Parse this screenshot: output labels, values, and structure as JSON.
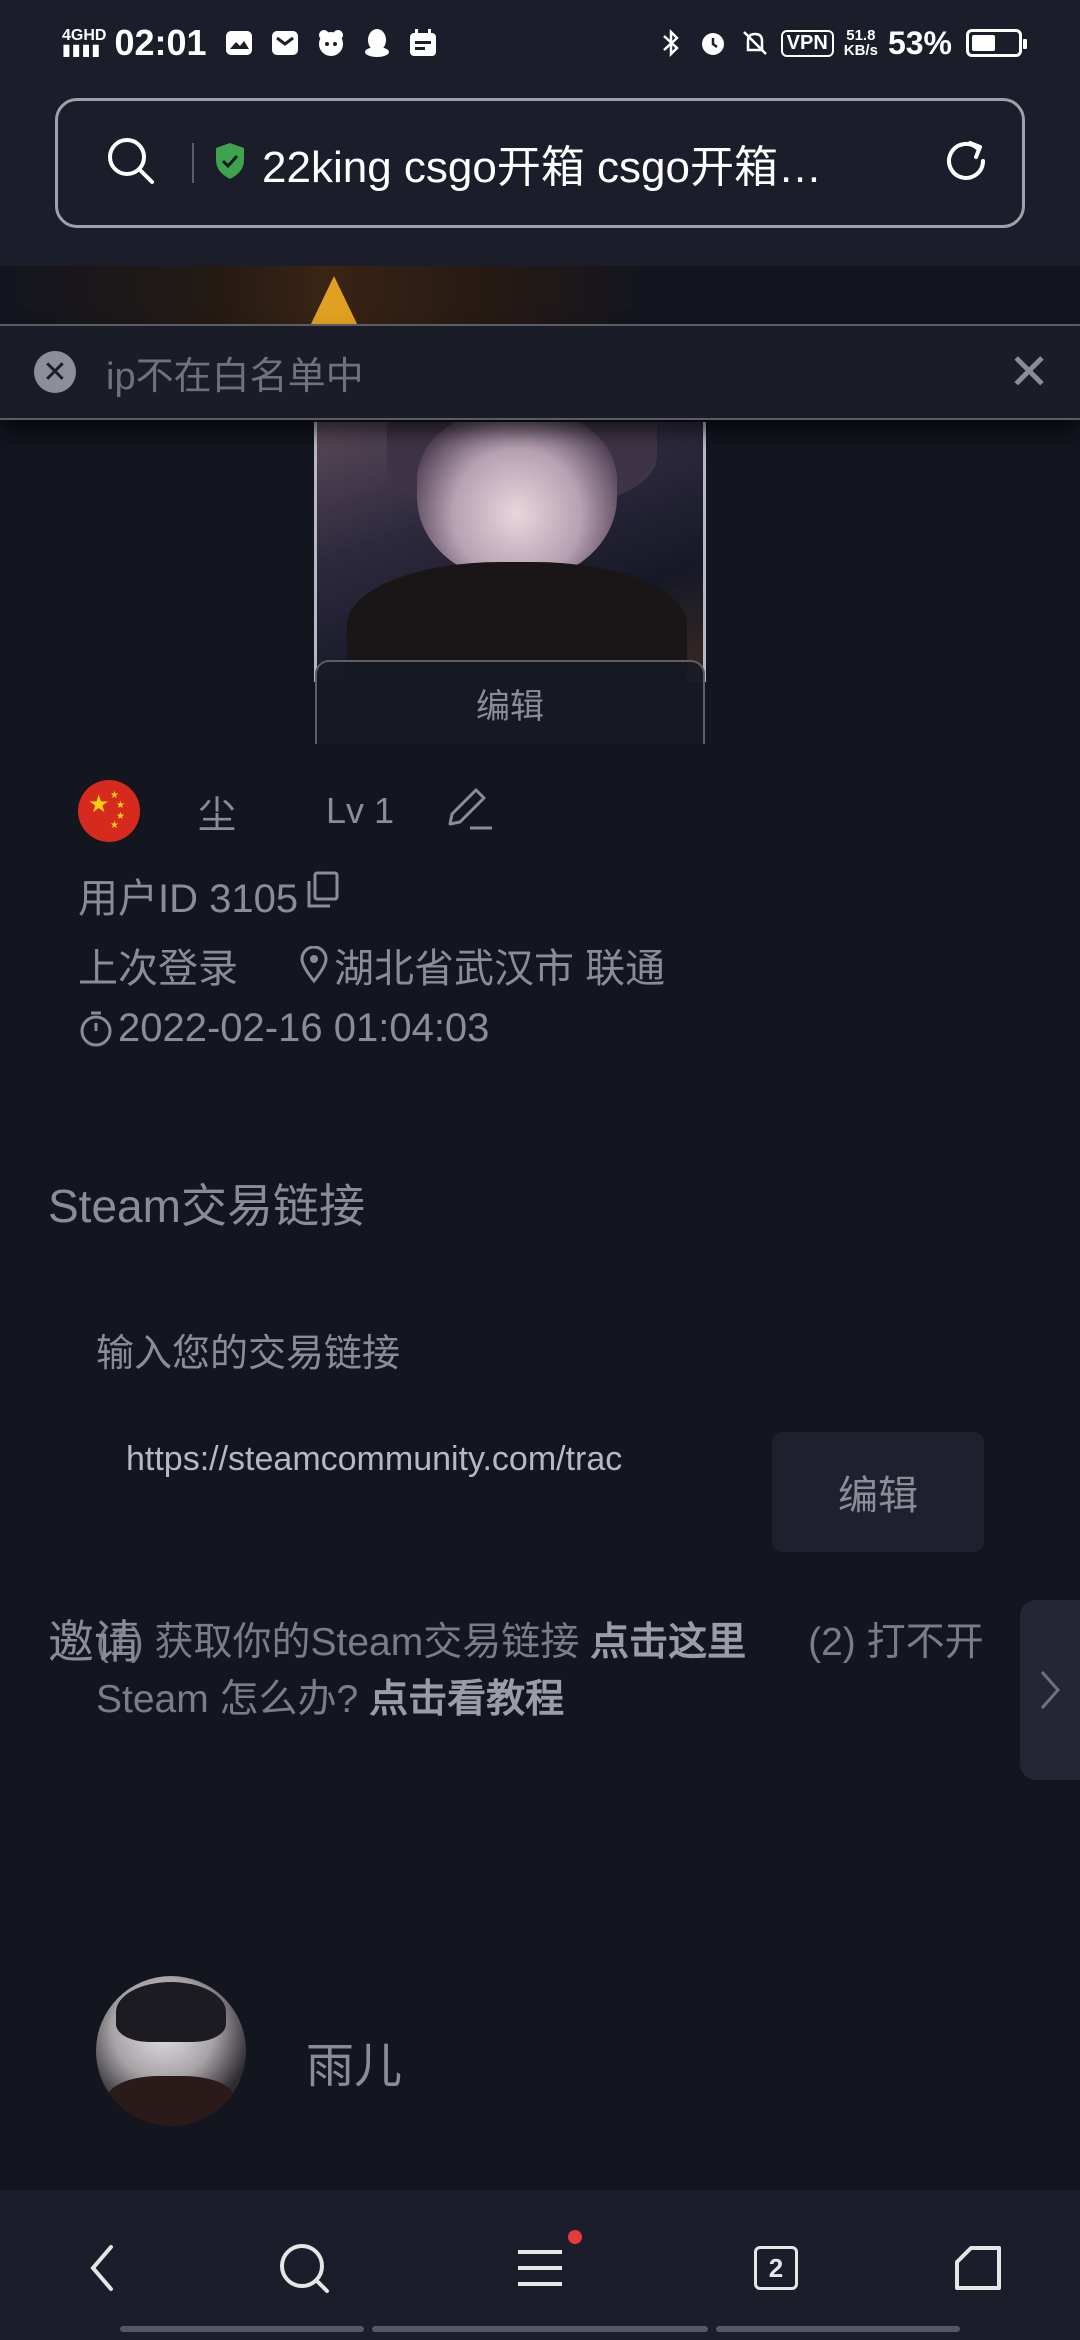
{
  "status_bar": {
    "network": "4GHD",
    "time": "02:01",
    "vpn": "VPN",
    "speed_value": "51.8",
    "speed_unit": "KB/s",
    "battery_percent": "53%",
    "battery_level": 0.53
  },
  "browser": {
    "url": "22king csgo开箱 csgo开箱…",
    "icons": [
      "search-icon",
      "shield-check-icon",
      "reload-icon"
    ],
    "secure_color": "#3fa34d"
  },
  "toast": {
    "message": "ip不在白名单中"
  },
  "profile": {
    "edit_avatar_label": "编辑",
    "nickname": "尘",
    "level": "Lv 1",
    "user_id": "用户ID 3105",
    "last_login_label": "上次登录",
    "location": "湖北省武汉市 联通",
    "last_login_time": "2022-02-16 01:04:03"
  },
  "trade": {
    "section_title": "Steam交易链接",
    "hint": "输入您的交易链接",
    "link_value": "https://steamcommunity.com/trac",
    "edit_label": "编辑",
    "help_1": "(1) 获取你的Steam交易链接 ",
    "help_1_link": "点击这里",
    "help_2": "(2) 打不开 Steam 怎么办? ",
    "help_2_link": "点击看教程"
  },
  "invite": {
    "section_title": "邀请",
    "name": "雨儿"
  },
  "bottom_nav": {
    "tab_count": "2",
    "notification_dot_color": "#e53b3b"
  }
}
